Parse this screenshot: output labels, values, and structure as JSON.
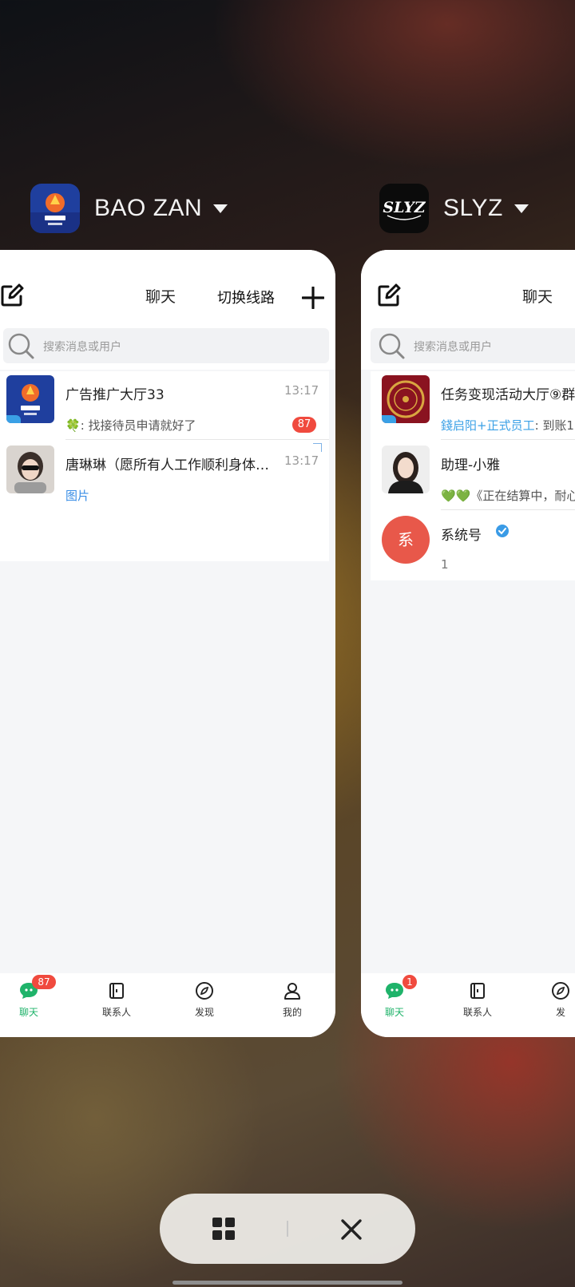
{
  "apps": [
    {
      "name": "BAO ZAN",
      "icon": "baozan-app-icon",
      "header": {
        "title": "聊天",
        "switch_label": "切换线路"
      },
      "search_placeholder": "搜索消息或用户",
      "chats": [
        {
          "title": "广告推广大厅33",
          "time": "13:17",
          "sender": "🍀",
          "message": ": 找接待员申请就好了",
          "unread": "87"
        },
        {
          "title": "唐琳琳（愿所有人工作顺利身体…",
          "time": "13:17",
          "message": "图片"
        }
      ],
      "tabs": [
        {
          "label": "聊天",
          "badge": "87",
          "icon": "chat-icon"
        },
        {
          "label": "联系人",
          "icon": "contacts-icon"
        },
        {
          "label": "发现",
          "icon": "compass-icon"
        },
        {
          "label": "我的",
          "icon": "profile-icon"
        }
      ]
    },
    {
      "name": "SLYZ",
      "icon": "slyz-app-icon",
      "header": {
        "title": "聊天"
      },
      "search_placeholder": "搜索消息或用户",
      "chats": [
        {
          "title": "任务变现活动大厅⑨群",
          "sender": "錢启阳+正式员工",
          "message": ": 到账1"
        },
        {
          "title": "助理-小雅",
          "message": "💚💚《正在结算中，耐心"
        },
        {
          "title": "系统号",
          "avatar_text": "系",
          "message": "1"
        }
      ],
      "tabs": [
        {
          "label": "聊天",
          "badge": "1",
          "icon": "chat-icon"
        },
        {
          "label": "联系人",
          "icon": "contacts-icon"
        },
        {
          "label": "发",
          "icon": "compass-icon"
        }
      ]
    }
  ],
  "bottom_controls": {
    "grid_icon": "grid-icon",
    "close_icon": "close-icon"
  },
  "colors": {
    "accent_green": "#1fb36a",
    "badge_red": "#f04a3e",
    "link_blue": "#3a8ee6"
  }
}
